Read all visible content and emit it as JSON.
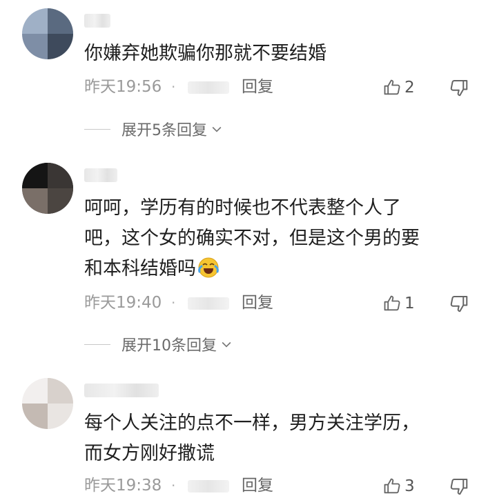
{
  "comments": [
    {
      "text": "你嫌弃她欺骗你那就不要结婚",
      "time": "昨天19:56",
      "dot": "·",
      "reply_label": "回复",
      "likes": "2",
      "expand_label": "展开5条回复"
    },
    {
      "text": "呵呵，学历有的时候也不代表整个人了\n吧，这个女的确实不对，但是这个男的要\n和本科结婚吗",
      "time": "昨天19:40",
      "dot": "·",
      "reply_label": "回复",
      "likes": "1",
      "expand_label": "展开10条回复"
    },
    {
      "text": "每个人关注的点不一样，男方关注学历，\n而女方刚好撒谎",
      "time": "昨天19:38",
      "dot": "·",
      "reply_label": "回复",
      "likes": "3"
    }
  ],
  "icons": {
    "like": "thumbs-up-icon",
    "dislike": "thumbs-down-icon",
    "expand": "chevron-down-icon",
    "emoji": "laughing-crying-emoji-icon"
  },
  "colors": {
    "text": "#1f1f1f",
    "meta": "#9a9a9a",
    "reply": "#666666",
    "emoji_face": "#f6c531"
  }
}
